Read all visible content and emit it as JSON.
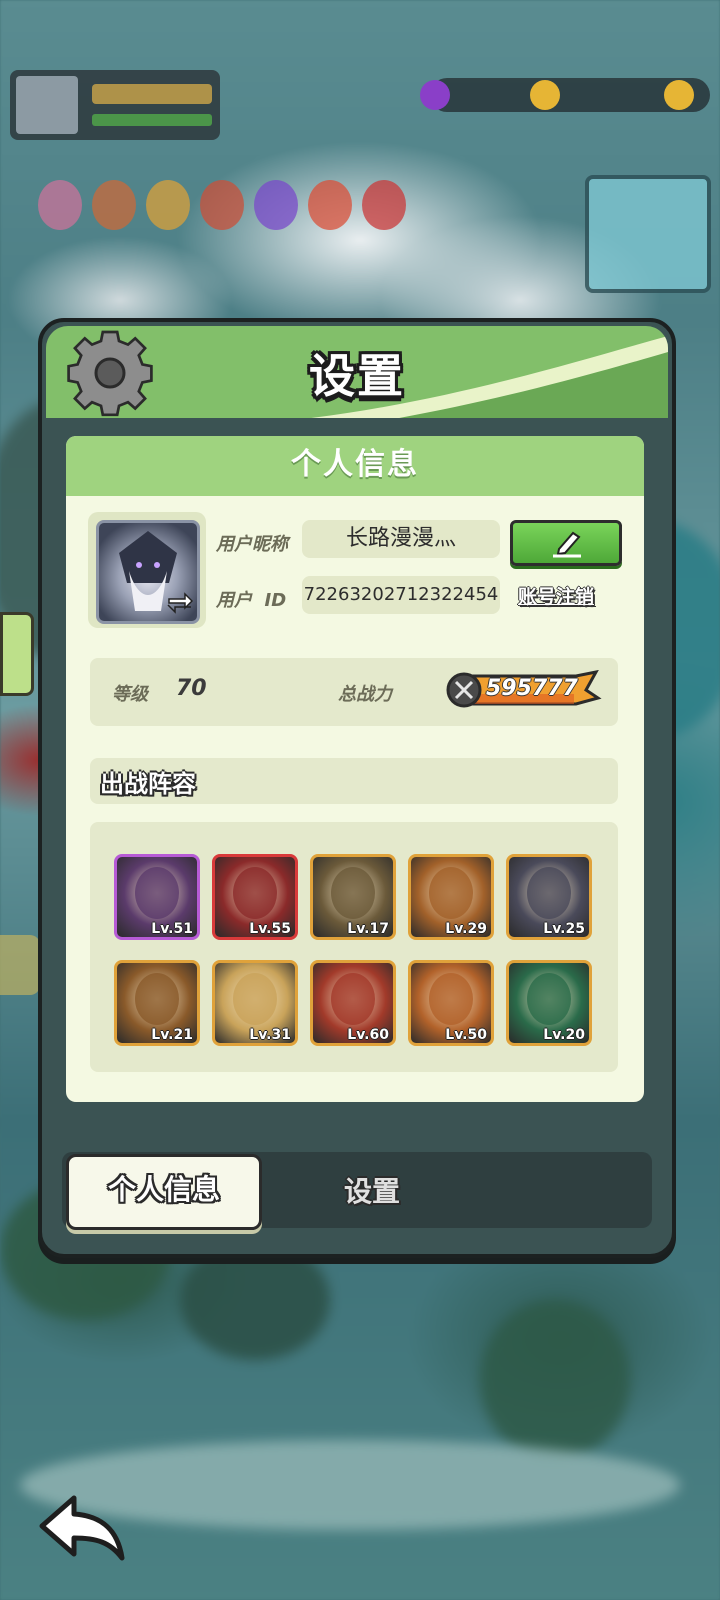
{
  "panel": {
    "title": "设置",
    "section_title": "个人信息"
  },
  "profile": {
    "nickname_label": "用户昵称",
    "nickname": "长路漫漫灬",
    "id_label": "用户  ID",
    "user_id": "72263202712322454",
    "cancel_account": "账号注销",
    "level_label": "等级",
    "level": "70",
    "power_label": "总战力",
    "power": "595777"
  },
  "lineup": {
    "title": "出战阵容",
    "heroes": [
      {
        "level": "Lv.51",
        "frame": "#b75bd6",
        "bg": "#5b3b6b"
      },
      {
        "level": "Lv.55",
        "frame": "#d93a3a",
        "bg": "#8b2a2a"
      },
      {
        "level": "Lv.17",
        "frame": "#e0a23a",
        "bg": "#6b5a3a"
      },
      {
        "level": "Lv.29",
        "frame": "#e0a23a",
        "bg": "#a2612a"
      },
      {
        "level": "Lv.25",
        "frame": "#e0a23a",
        "bg": "#4a4a5a"
      },
      {
        "level": "Lv.21",
        "frame": "#e0a23a",
        "bg": "#8a5a2a"
      },
      {
        "level": "Lv.31",
        "frame": "#e0a23a",
        "bg": "#c9a35a"
      },
      {
        "level": "Lv.60",
        "frame": "#e0a23a",
        "bg": "#a23a2a"
      },
      {
        "level": "Lv.50",
        "frame": "#e0a23a",
        "bg": "#b2622a"
      },
      {
        "level": "Lv.20",
        "frame": "#e0a23a",
        "bg": "#2a6b4a"
      }
    ]
  },
  "tabs": {
    "active": "个人信息",
    "inactive": "设置"
  },
  "colors": {
    "header_green": "#82bf6a",
    "card_bg": "#f4f9e2",
    "edit_green": "#4ea838",
    "power_orange": "#f0a030"
  }
}
